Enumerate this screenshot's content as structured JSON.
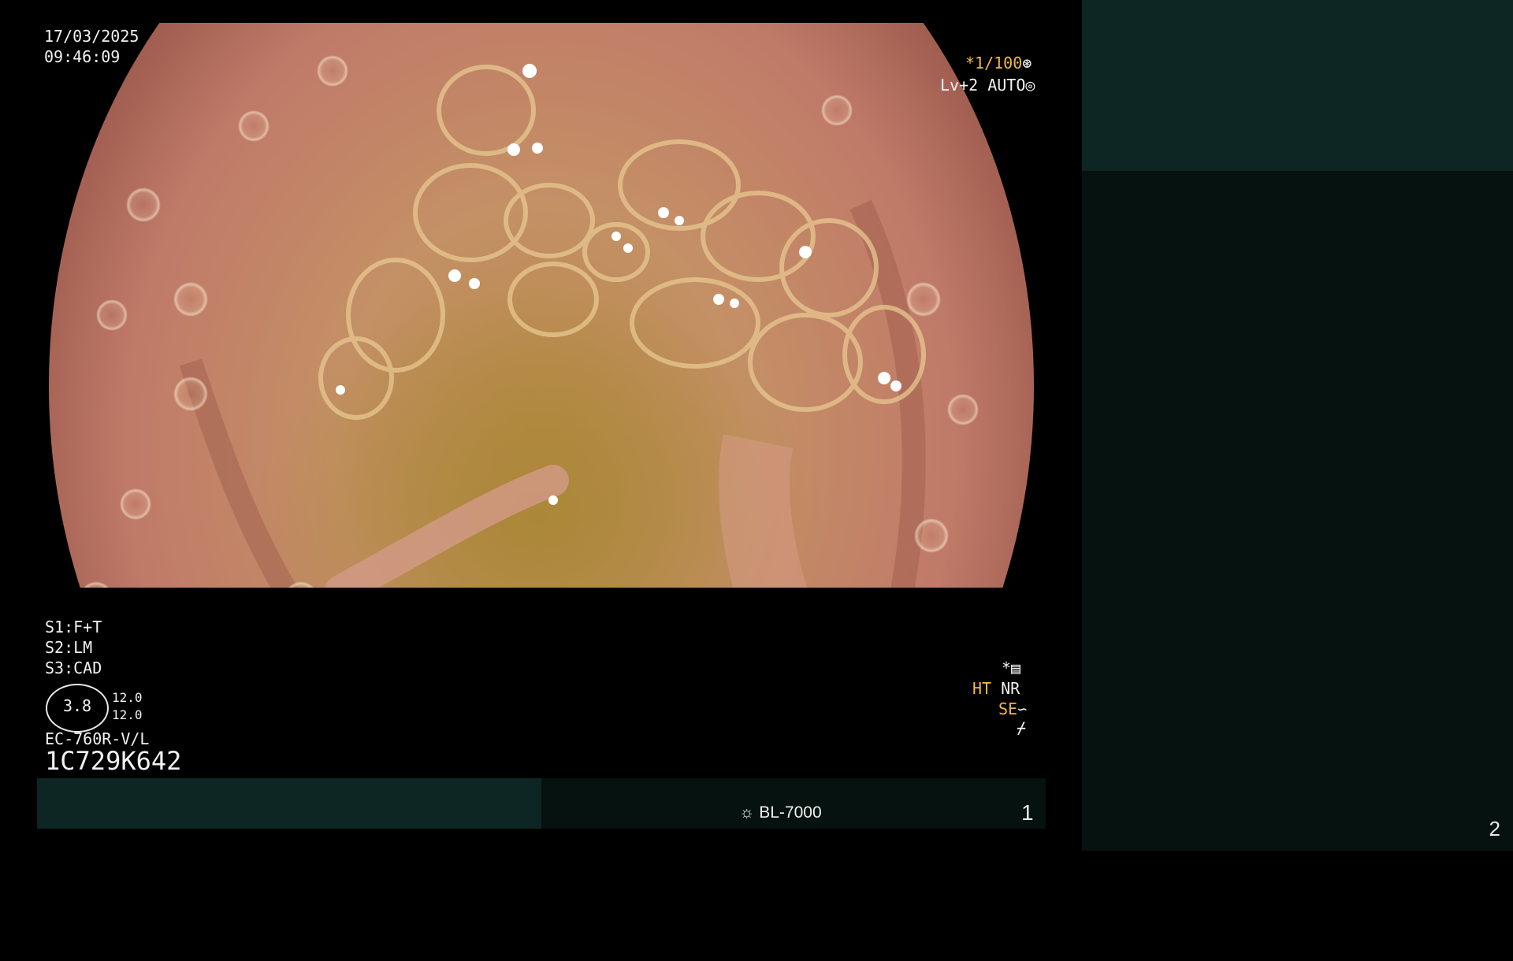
{
  "overlay": {
    "date": "17/03/2025",
    "time": "09:46:09",
    "shutter": "*1/100",
    "shutter_icon": "aperture-icon",
    "level": "Lv+2 AUTO",
    "level_icon": "iris-icon",
    "settings": {
      "s1_key": "S1:",
      "s1_value": "F+T",
      "s2_key": "S2:",
      "s2_value": "LM",
      "s3_key": "S3:",
      "s3_value": "CAD"
    },
    "gauge_value": "3.8",
    "gauge_top": "12.0",
    "gauge_bottom": "12.0",
    "scope_model": "EC-760R-V/L",
    "scope_serial": "1C729K642",
    "mode_star": "*",
    "mode_ht": "HT",
    "mode_nr": "NR",
    "mode_se": "SE",
    "light_source": "BL-7000",
    "page_left": "1",
    "page_right": "2"
  },
  "colors": {
    "panel_teal": "#0d2624",
    "panel_dark": "#06120f",
    "amber": "#f2b84a",
    "mucosa": "#c48a72"
  }
}
